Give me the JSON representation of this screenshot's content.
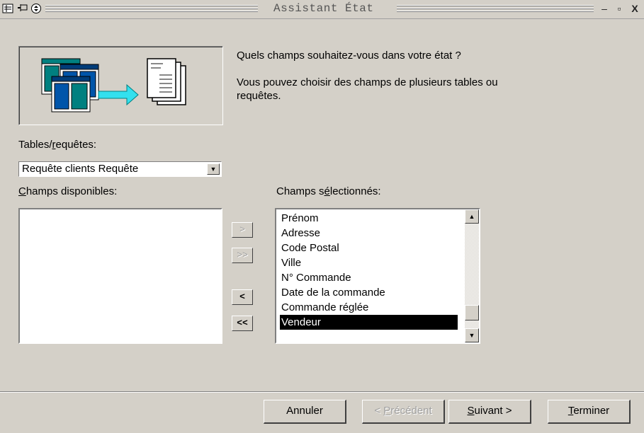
{
  "window": {
    "title": "Assistant État"
  },
  "intro": {
    "question": "Quels champs souhaitez-vous dans votre état ?",
    "info_line1": "Vous pouvez choisir des champs de plusieurs tables ou",
    "info_line2": "requêtes."
  },
  "tables": {
    "label_pre": "Tables/",
    "label_accel": "r",
    "label_post": "equêtes:",
    "selected": "Requête clients Requête"
  },
  "available": {
    "label_accel": "C",
    "label_post": "hamps disponibles:",
    "items": []
  },
  "selected_fields": {
    "label_pre": "Champs s",
    "label_accel": "é",
    "label_post": "lectionnés:",
    "items": [
      "Prénom",
      "Adresse",
      "Code Postal",
      "Ville",
      "N° Commande",
      "Date de la commande",
      "Commande réglée",
      "Vendeur"
    ],
    "highlighted": "Vendeur"
  },
  "move_buttons": {
    "add_one": ">",
    "add_all": ">>",
    "remove_one": "<",
    "remove_all": "<<"
  },
  "footer": {
    "cancel": "Annuler",
    "back_pre": "< ",
    "back_accel": "P",
    "back_post": "récédent",
    "next_accel": "S",
    "next_post": "uivant >",
    "finish_accel": "T",
    "finish_post": "erminer"
  }
}
